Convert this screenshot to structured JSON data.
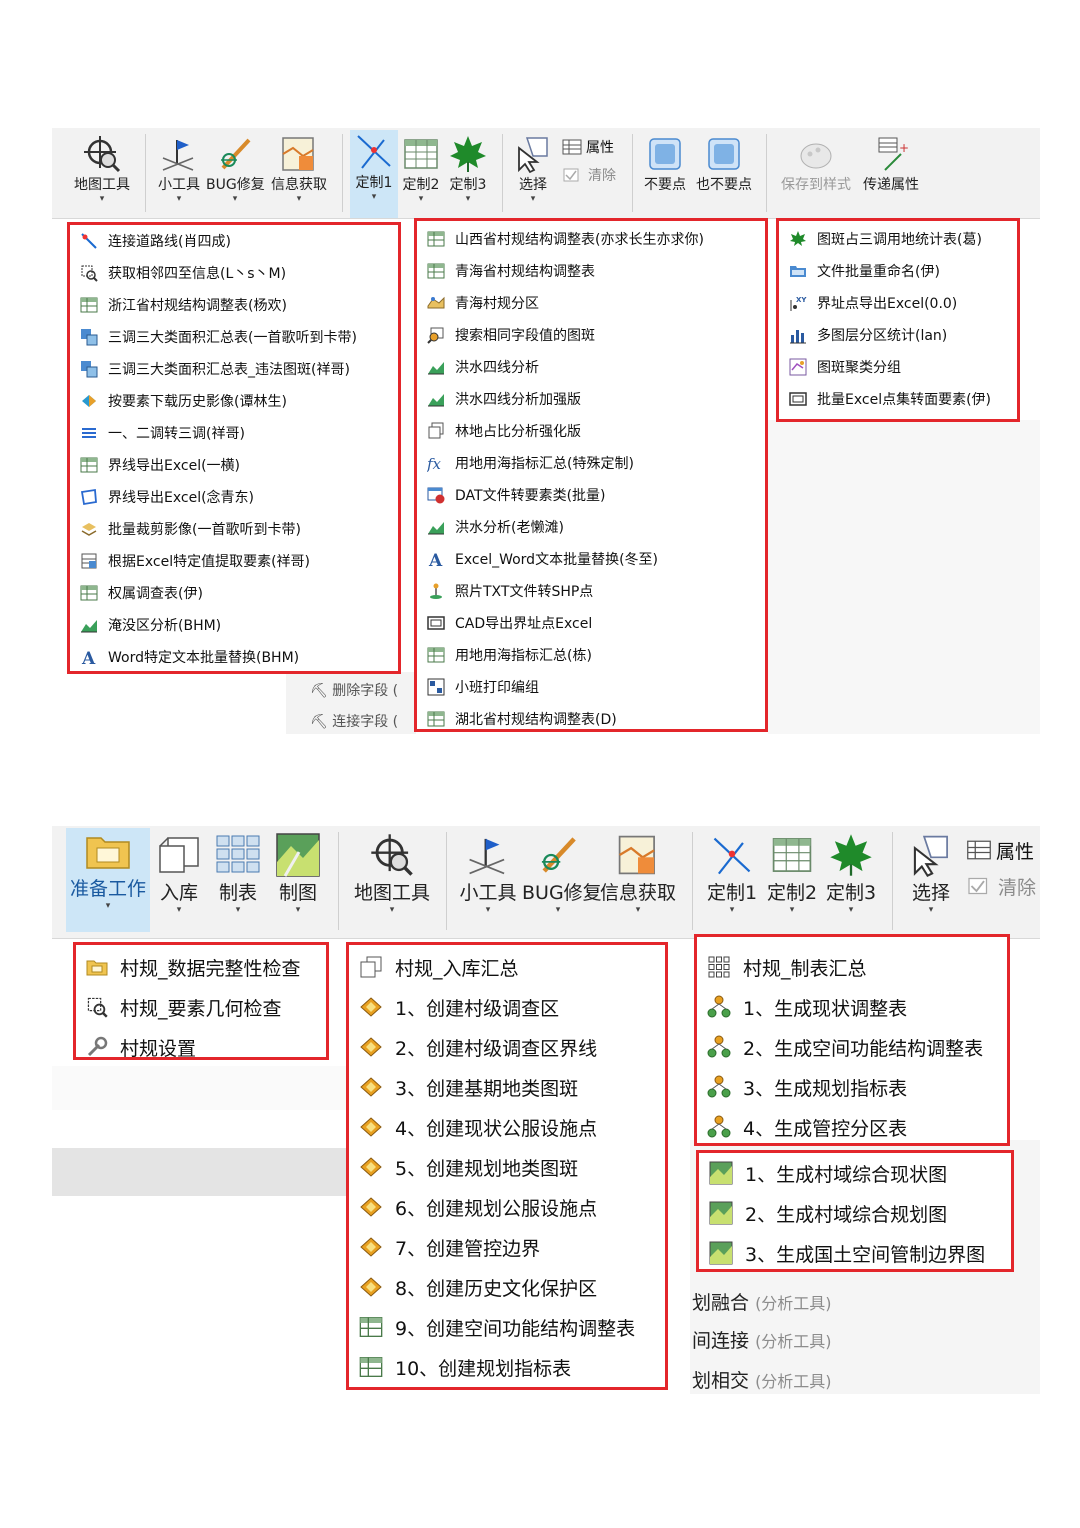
{
  "top_ribbon": {
    "map_tools": "地图工具",
    "small_tools": "小工具",
    "bug_fix": "BUG修复",
    "info_get": "信息获取",
    "custom1": "定制1",
    "custom2": "定制2",
    "custom3": "定制3",
    "select": "选择",
    "attribute": "属性",
    "clear": "清除",
    "unwanted_point": "不要点",
    "also_unwanted_point": "也不要点",
    "save_style": "保存到样式",
    "pass_attribute": "传递属性"
  },
  "menu1": [
    "连接道路线(肖四成)",
    "获取相邻四至信息(L丶s丶M)",
    "浙江省村规结构调整表(杨欢)",
    "三调三大类面积汇总表(一首歌听到卡带)",
    "三调三大类面积汇总表_违法图斑(祥哥)",
    "按要素下载历史影像(谭林生)",
    "一、二调转三调(祥哥)",
    "界线导出Excel(一横)",
    "界线导出Excel(念青东)",
    "批量裁剪影像(一首歌听到卡带)",
    "根据Excel特定值提取要素(祥哥)",
    "权属调查表(伊)",
    "淹没区分析(BHM)",
    "Word特定文本批量替换(BHM)"
  ],
  "menu1_behind": [
    "删除字段 (",
    "连接字段 ("
  ],
  "menu2": [
    "山西省村规结构调整表(亦求长生亦求你)",
    "青海省村规结构调整表",
    "青海村规分区",
    "搜索相同字段值的图斑",
    "洪水四线分析",
    "洪水四线分析加强版",
    "林地占比分析强化版",
    "用地用海指标汇总(特殊定制)",
    "DAT文件转要素类(批量)",
    "洪水分析(老懒滩)",
    "Excel_Word文本批量替换(冬至)",
    "照片TXT文件转SHP点",
    "CAD导出界址点Excel",
    "用地用海指标汇总(栋)",
    "小班打印编组",
    "湖北省村规结构调整表(D)"
  ],
  "menu3": [
    "图斑占三调用地统计表(葛)",
    "文件批量重命名(伊)",
    "界址点导出Excel(0.0)",
    "多图层分区统计(lan)",
    "图斑聚类分组",
    "批量Excel点集转面要素(伊)"
  ],
  "bottom_ribbon": {
    "prepare": "准备工作",
    "import": "入库",
    "tabulate": "制表",
    "mapping": "制图",
    "map_tools": "地图工具",
    "small_tools": "小工具",
    "bug_fix": "BUG修复",
    "info_get": "信息获取",
    "custom1": "定制1",
    "custom2": "定制2",
    "custom3": "定制3",
    "select": "选择",
    "attribute": "属性",
    "clear": "清除"
  },
  "menu4": [
    "村规_数据完整性检查",
    "村规_要素几何检查",
    "村规设置"
  ],
  "menu5": [
    "村规_入库汇总",
    "1、创建村级调查区",
    "2、创建村级调查区界线",
    "3、创建基期地类图斑",
    "4、创建现状公服设施点",
    "5、创建规划地类图斑",
    "6、创建规划公服设施点",
    "7、创建管控边界",
    "8、创建历史文化保护区",
    "9、创建空间功能结构调整表",
    "10、创建规划指标表"
  ],
  "menu6": [
    "村规_制表汇总",
    "1、生成现状调整表",
    "2、生成空间功能结构调整表",
    "3、生成规划指标表",
    "4、生成管控分区表"
  ],
  "menu7": [
    "1、生成村域综合现状图",
    "2、生成村域综合规划图",
    "3、生成国土空间管制边界图"
  ],
  "behind_items": [
    {
      "main": "划融合",
      "tag": "(分析工具)"
    },
    {
      "main": "间连接",
      "tag": "(分析工具)"
    },
    {
      "main": "划相交",
      "tag": "(分析工具)"
    }
  ]
}
